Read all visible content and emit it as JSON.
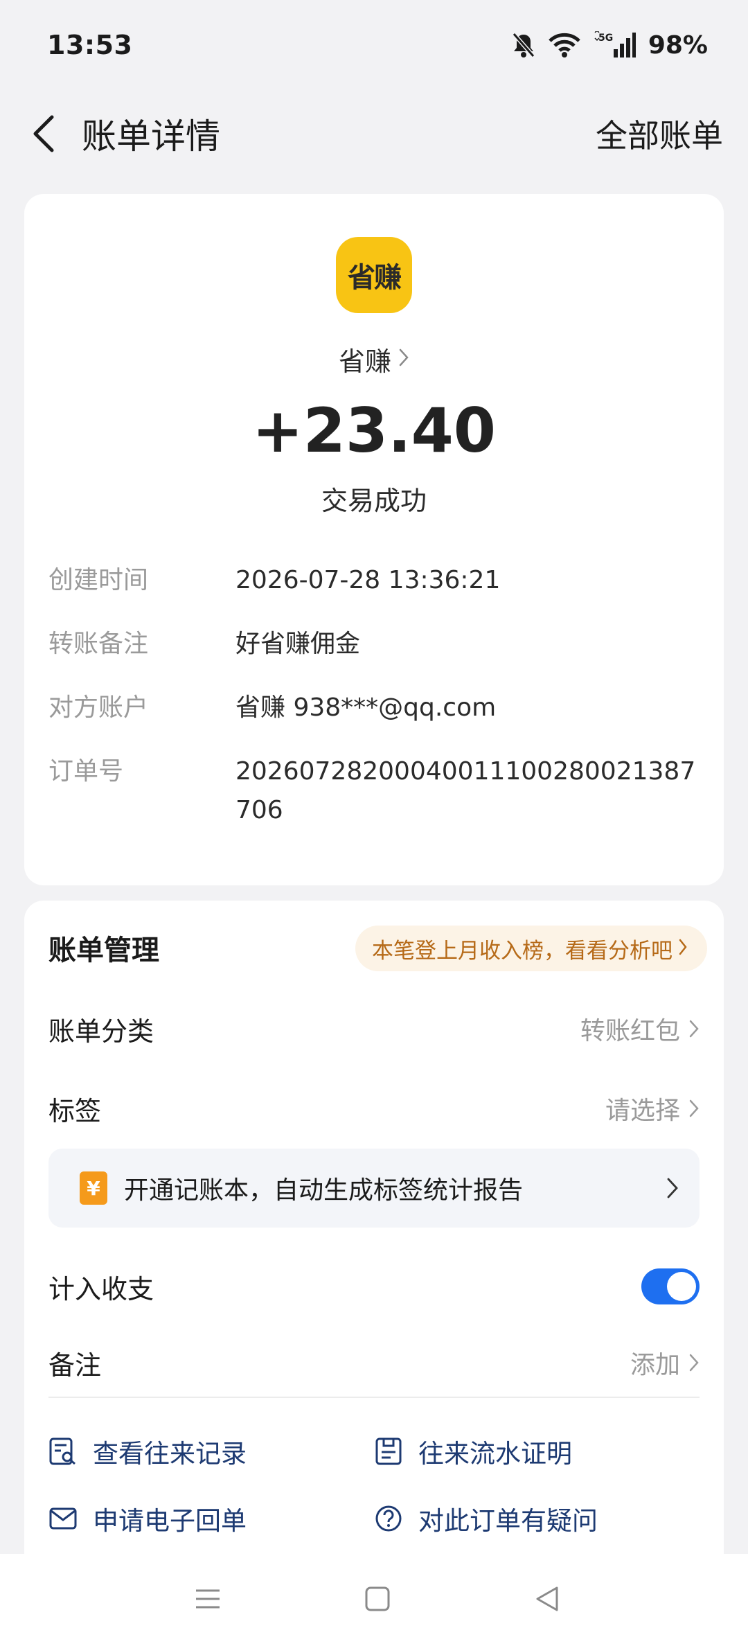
{
  "status_bar": {
    "time": "13:53",
    "network": "5G",
    "battery": "98%"
  },
  "header": {
    "title": "账单详情",
    "all_bills": "全部账单"
  },
  "merchant": {
    "logo_text": "省赚",
    "name": "省赚",
    "amount": "+23.40",
    "status": "交易成功"
  },
  "details": [
    {
      "label": "创建时间",
      "value": "2026-07-28 13:36:21"
    },
    {
      "label": "转账备注",
      "value": "好省赚佣金"
    },
    {
      "label": "对方账户",
      "value": "省赚 938***@qq.com"
    },
    {
      "label": "订单号",
      "value": "20260728200040011100280021387706"
    }
  ],
  "manage": {
    "title": "账单管理",
    "promo": "本笔登上月收入榜，看看分析吧",
    "category": {
      "label": "账单分类",
      "value": "转账红包"
    },
    "tag": {
      "label": "标签",
      "value": "请选择"
    },
    "ledger_banner": {
      "icon": "¥",
      "text": "开通记账本，自动生成标签统计报告"
    },
    "include": {
      "label": "计入收支",
      "enabled": true
    },
    "remark": {
      "label": "备注",
      "value": "添加"
    }
  },
  "actions": {
    "history": "查看往来记录",
    "proof": "往来流水证明",
    "receipt": "申请电子回单",
    "question": "对此订单有疑问"
  },
  "colors": {
    "accent": "#1e6ff0",
    "logo": "#f8c414",
    "promo_text": "#b66a18",
    "link": "#1d3a72"
  }
}
